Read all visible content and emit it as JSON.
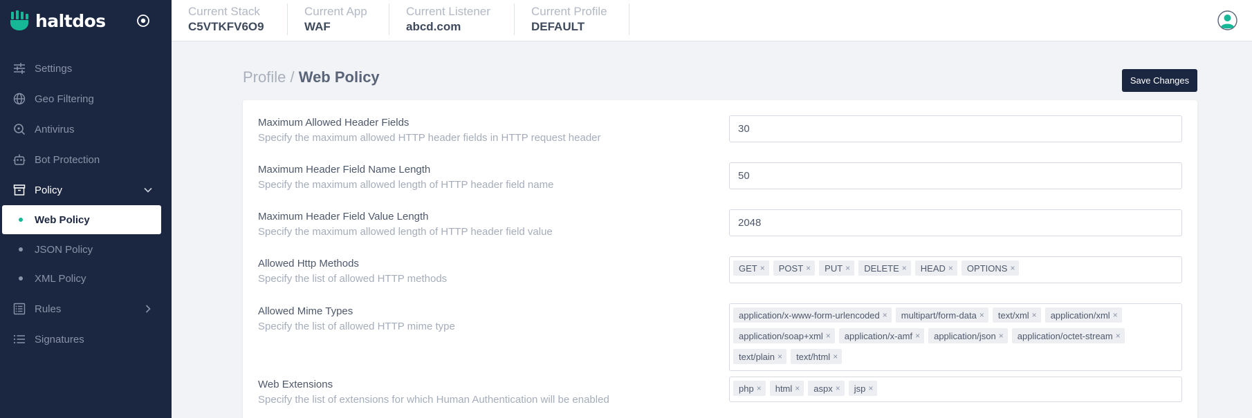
{
  "brand": {
    "name": "haltdos"
  },
  "topbar": {
    "contexts": [
      {
        "label": "Current Stack",
        "value": "C5VTKFV6O9"
      },
      {
        "label": "Current App",
        "value": "WAF"
      },
      {
        "label": "Current Listener",
        "value": "abcd.com"
      },
      {
        "label": "Current Profile",
        "value": "DEFAULT"
      }
    ]
  },
  "sidebar": {
    "items": [
      {
        "label": "Settings",
        "icon": "sliders-icon"
      },
      {
        "label": "Geo Filtering",
        "icon": "globe-icon"
      },
      {
        "label": "Antivirus",
        "icon": "search-icon"
      },
      {
        "label": "Bot Protection",
        "icon": "robot-icon"
      },
      {
        "label": "Policy",
        "icon": "archive-icon"
      },
      {
        "label": "Rules",
        "icon": "list-box-icon"
      },
      {
        "label": "Signatures",
        "icon": "list-icon"
      }
    ],
    "policy_sub": [
      {
        "label": "Web Policy",
        "active": true
      },
      {
        "label": "JSON Policy"
      },
      {
        "label": "XML Policy"
      }
    ]
  },
  "page": {
    "breadcrumb_parent": "Profile",
    "breadcrumb_sep": " / ",
    "breadcrumb_current": "Web Policy",
    "save_label": "Save Changes"
  },
  "fields": [
    {
      "title": "Maximum Allowed Header Fields",
      "desc": "Specify the maximum allowed HTTP header fields in HTTP request header",
      "value": "30"
    },
    {
      "title": "Maximum Header Field Name Length",
      "desc": "Specify the maximum allowed length of HTTP header field name",
      "value": "50"
    },
    {
      "title": "Maximum Header Field Value Length",
      "desc": "Specify the maximum allowed length of HTTP header field value",
      "value": "2048"
    },
    {
      "title": "Allowed Http Methods",
      "desc": "Specify the list of allowed HTTP methods",
      "tags": [
        "GET",
        "POST",
        "PUT",
        "DELETE",
        "HEAD",
        "OPTIONS"
      ]
    },
    {
      "title": "Allowed Mime Types",
      "desc": "Specify the list of allowed HTTP mime type",
      "tags": [
        "application/x-www-form-urlencoded",
        "multipart/form-data",
        "text/xml",
        "application/xml",
        "application/soap+xml",
        "application/x-amf",
        "application/json",
        "application/octet-stream",
        "text/plain",
        "text/html"
      ]
    },
    {
      "title": "Web Extensions",
      "desc": "Specify the list of extensions for which Human Authentication will be enabled",
      "tags": [
        "php",
        "html",
        "aspx",
        "jsp"
      ]
    }
  ],
  "colors": {
    "sidebar": "#1b2640",
    "accent": "#17b897",
    "background": "#f1f3f7"
  }
}
